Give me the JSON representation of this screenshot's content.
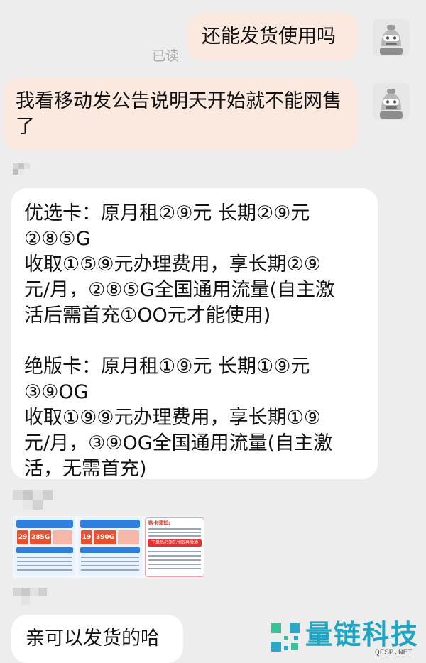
{
  "messages": {
    "m1": {
      "text": "还能发货使用吗",
      "status": "已读"
    },
    "m2": {
      "text": "我看移动发公告说明天开始就不能网售了"
    },
    "m3": {
      "line1": "优选卡：原月租②⑨元  长期②⑨元",
      "line2": "②⑧⑤G",
      "line3": "收取①⑤⑨元办理费用，享长期②⑨",
      "line4": "元/月，②⑧⑤G全国通用流量(自主激",
      "line5": "活后需首充①OO元才能使用)",
      "line6": "绝版卡：原月租①⑨元  长期①⑨元",
      "line7": "③⑨OG",
      "line8": "收取①⑨⑨元办理费用，享长期①⑨",
      "line9": "元/月，③⑨OG全国通用流量(自主激",
      "line10": "活，无需首充)"
    },
    "m4": {
      "card1_price_a": "29",
      "card1_price_b": "285G",
      "card2_price_a": "19",
      "card2_price_b": "390G",
      "notice_title": "购卡须知:",
      "notice_banner": "下单后必须先领取再激活"
    },
    "m5": {
      "text": "亲可以发货的哈"
    }
  },
  "watermark": {
    "name": "量链科技",
    "url": "QFSP.NET"
  }
}
